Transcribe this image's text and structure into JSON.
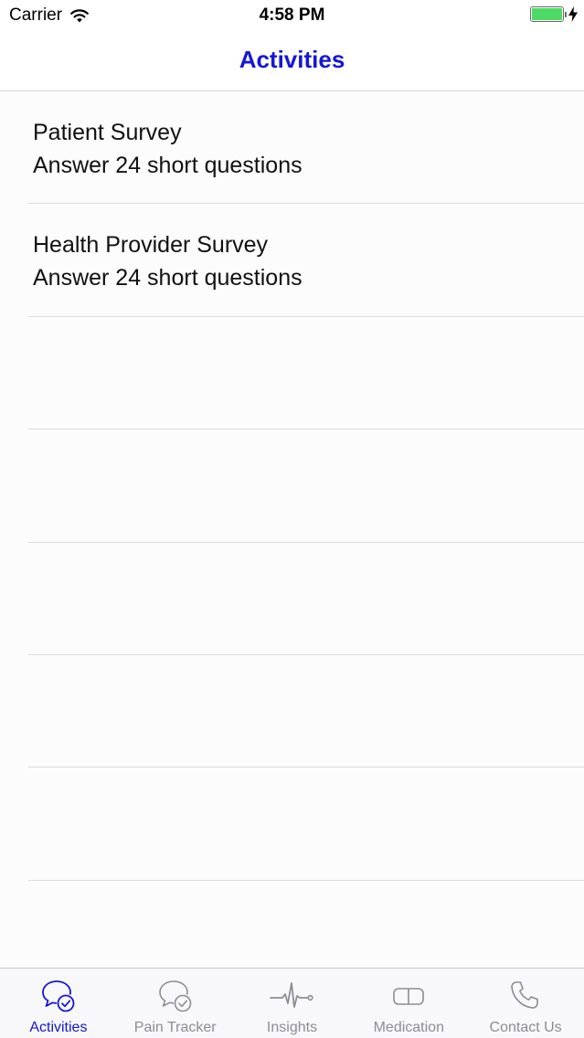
{
  "status_bar": {
    "carrier": "Carrier",
    "time": "4:58 PM",
    "battery_level": 1.0
  },
  "nav": {
    "title": "Activities"
  },
  "activities": [
    {
      "title": "Patient Survey",
      "subtitle": "Answer 24 short questions"
    },
    {
      "title": "Health Provider Survey",
      "subtitle": "Answer 24 short questions"
    }
  ],
  "tabs": [
    {
      "label": "Activities",
      "icon": "chat-check-icon",
      "active": true
    },
    {
      "label": "Pain Tracker",
      "icon": "chat-check-icon",
      "active": false
    },
    {
      "label": "Insights",
      "icon": "heartbeat-icon",
      "active": false
    },
    {
      "label": "Medication",
      "icon": "pill-icon",
      "active": false
    },
    {
      "label": "Contact Us",
      "icon": "phone-icon",
      "active": false
    }
  ],
  "colors": {
    "accent": "#1515d9",
    "inactive": "#8d8d92",
    "battery": "#4cd964",
    "separator": "#dcdcdf"
  }
}
